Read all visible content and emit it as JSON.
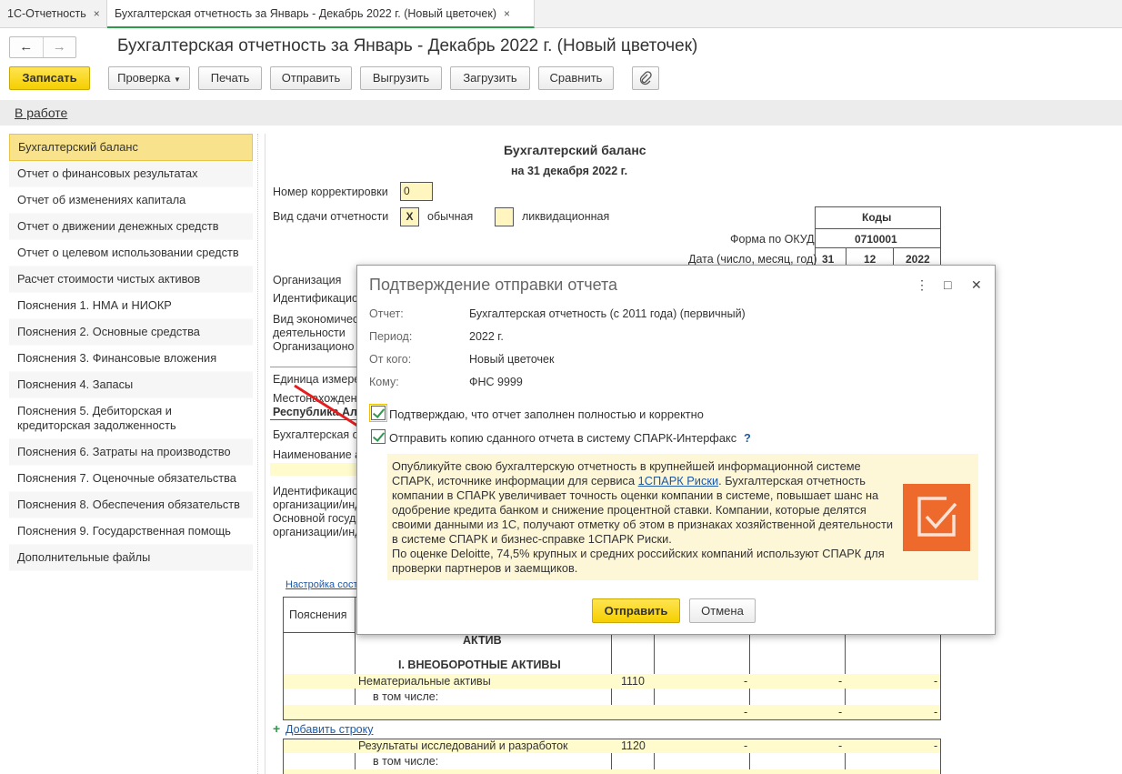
{
  "tabs": [
    {
      "label": "1С-Отчетность",
      "close": "×"
    },
    {
      "label": "Бухгалтерская отчетность за Январь - Декабрь 2022 г. (Новый цветочек)",
      "close": "×"
    }
  ],
  "header": {
    "back": "←",
    "forward": "→",
    "title": "Бухгалтерская отчетность за Январь - Декабрь 2022 г. (Новый цветочек)"
  },
  "toolbar": {
    "save": "Записать",
    "check": "Проверка",
    "print": "Печать",
    "send": "Отправить",
    "export": "Выгрузить",
    "import": "Загрузить",
    "compare": "Сравнить",
    "attach_icon": "paperclip-icon"
  },
  "status": {
    "label": "В работе"
  },
  "sidebar": {
    "items": [
      "Бухгалтерский баланс",
      "Отчет о финансовых результатах",
      "Отчет об изменениях капитала",
      "Отчет о движении денежных средств",
      "Отчет о целевом использовании средств",
      "Расчет стоимости чистых активов",
      "Пояснения 1. НМА и НИОКР",
      "Пояснения 2. Основные средства",
      "Пояснения 3. Финансовые вложения",
      "Пояснения 4. Запасы",
      "Пояснения 5. Дебиторская и кредиторская задолженность",
      "Пояснения 6. Затраты на производство",
      "Пояснения 7. Оценочные обязательства",
      "Пояснения 8. Обеспечения обязательств",
      "Пояснения 9. Государственная помощь",
      "Дополнительные файлы"
    ]
  },
  "report": {
    "title": "Бухгалтерский баланс",
    "date": "на 31 декабря 2022 г.",
    "corr_label": "Номер корректировки",
    "corr_value": "0",
    "kind_label": "Вид сдачи отчетности",
    "kind_mark": "X",
    "kind_normal": "обычная",
    "kind_liquid": "ликвидационная",
    "codes_header": "Коды",
    "okud_label": "Форма по ОКУД",
    "okud_value": "0710001",
    "date_label": "Дата (число, месяц, год)",
    "day": "31",
    "month": "12",
    "year": "2022",
    "org_label": "Организация",
    "ident_label": "Идентификацио",
    "econ_label": "Вид экономичес",
    "econ_label2": "деятельности",
    "orgform_label": "Организационо",
    "unit_label": "Единица измере",
    "location_label": "Местонахожден",
    "republic": "Республика Алт",
    "buh_label": "Бухгалтерская от",
    "name_label": "Наименование а",
    "ident2_label": "Идентификацио",
    "ident2_label2": "организации/инд",
    "main_label": "Основной госуда",
    "main_label2": "организации/инд",
    "settings_link": "Настройка сост",
    "col_notes": "Пояснения",
    "asset": "АКТИВ",
    "section1": "I. ВНЕОБОРОТНЫЕ АКТИВЫ",
    "rows": [
      {
        "name": "Нематериальные активы",
        "code": "1110",
        "v1": "-",
        "v2": "-",
        "v3": "-"
      },
      {
        "name": "в том числе:",
        "code": "",
        "v1": "-",
        "v2": "-",
        "v3": "-"
      },
      {
        "name": "Результаты исследований и разработок",
        "code": "1120",
        "v1": "-",
        "v2": "-",
        "v3": "-"
      },
      {
        "name": "в том числе:",
        "code": "",
        "v1": "",
        "v2": "",
        "v3": ""
      }
    ],
    "add_row_plus": "+",
    "add_row": "Добавить строку"
  },
  "dialog": {
    "title": "Подтверждение отправки отчета",
    "more": "⋮",
    "maximize": "□",
    "close": "✕",
    "report_label": "Отчет:",
    "report_value": "Бухгалтерская отчетность (с 2011 года) (первичный)",
    "period_label": "Период:",
    "period_value": "2022 г.",
    "from_label": "От кого:",
    "from_value": "Новый цветочек",
    "to_label": "Кому:",
    "to_value": "ФНС 9999",
    "confirm_text": "Подтверждаю, что отчет заполнен полностью и корректно",
    "spark_text": "Отправить копию сданного отчета в систему СПАРК-Интерфакс",
    "help": "?",
    "promo_1": "Опубликуйте свою бухгалтерскую отчетность в крупнейшей информационной системе СПАРК, источнике информации для сервиса ",
    "promo_link": "1СПАРК Риски",
    "promo_2": ". Бухгалтерская отчетность компании в СПАРК увеличивает точность оценки компании в системе, повышает шанс на одобрение кредита банком и снижение процентной ставки. Компании, которые делятся своими данными из 1С, получают отметку об этом в признаках хозяйственной деятельности в системе СПАРК и бизнес-справке 1СПАРК Риски.",
    "promo_3": "По оценке Deloitte, 74,5% крупных и средних российских компаний используют СПАРК для проверки партнеров и заемщиков.",
    "send": "Отправить",
    "cancel": "Отмена"
  },
  "colors": {
    "accent_yellow": "#f5cf00",
    "check_green": "#2b9a49",
    "spark_orange": "#ee6a2c",
    "arrow_red": "#e41e1e",
    "link_blue": "#1d58a6"
  }
}
